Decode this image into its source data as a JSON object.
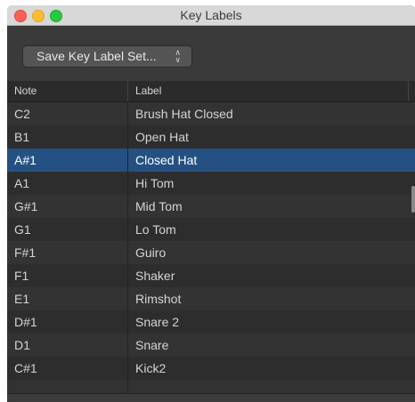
{
  "window": {
    "title": "Key Labels"
  },
  "toolbar": {
    "save_label": "Save Key Label Set...",
    "save_chevron": "⌃⌄"
  },
  "table": {
    "headers": {
      "note": "Note",
      "label": "Label"
    },
    "rows": [
      {
        "note": "C2",
        "label": "Brush Hat Closed",
        "selected": false
      },
      {
        "note": "B1",
        "label": "Open Hat",
        "selected": false
      },
      {
        "note": "A#1",
        "label": "Closed Hat",
        "selected": true
      },
      {
        "note": "A1",
        "label": "Hi Tom",
        "selected": false
      },
      {
        "note": "G#1",
        "label": "Mid Tom",
        "selected": false
      },
      {
        "note": "G1",
        "label": "Lo Tom",
        "selected": false
      },
      {
        "note": "F#1",
        "label": "Guiro",
        "selected": false
      },
      {
        "note": "F1",
        "label": "Shaker",
        "selected": false
      },
      {
        "note": "E1",
        "label": "Rimshot",
        "selected": false
      },
      {
        "note": "D#1",
        "label": "Snare 2",
        "selected": false
      },
      {
        "note": "D1",
        "label": "Snare",
        "selected": false
      },
      {
        "note": "C#1",
        "label": "Kick2",
        "selected": false
      }
    ]
  },
  "colors": {
    "selection": "#245181",
    "window_bg": "#323232"
  }
}
